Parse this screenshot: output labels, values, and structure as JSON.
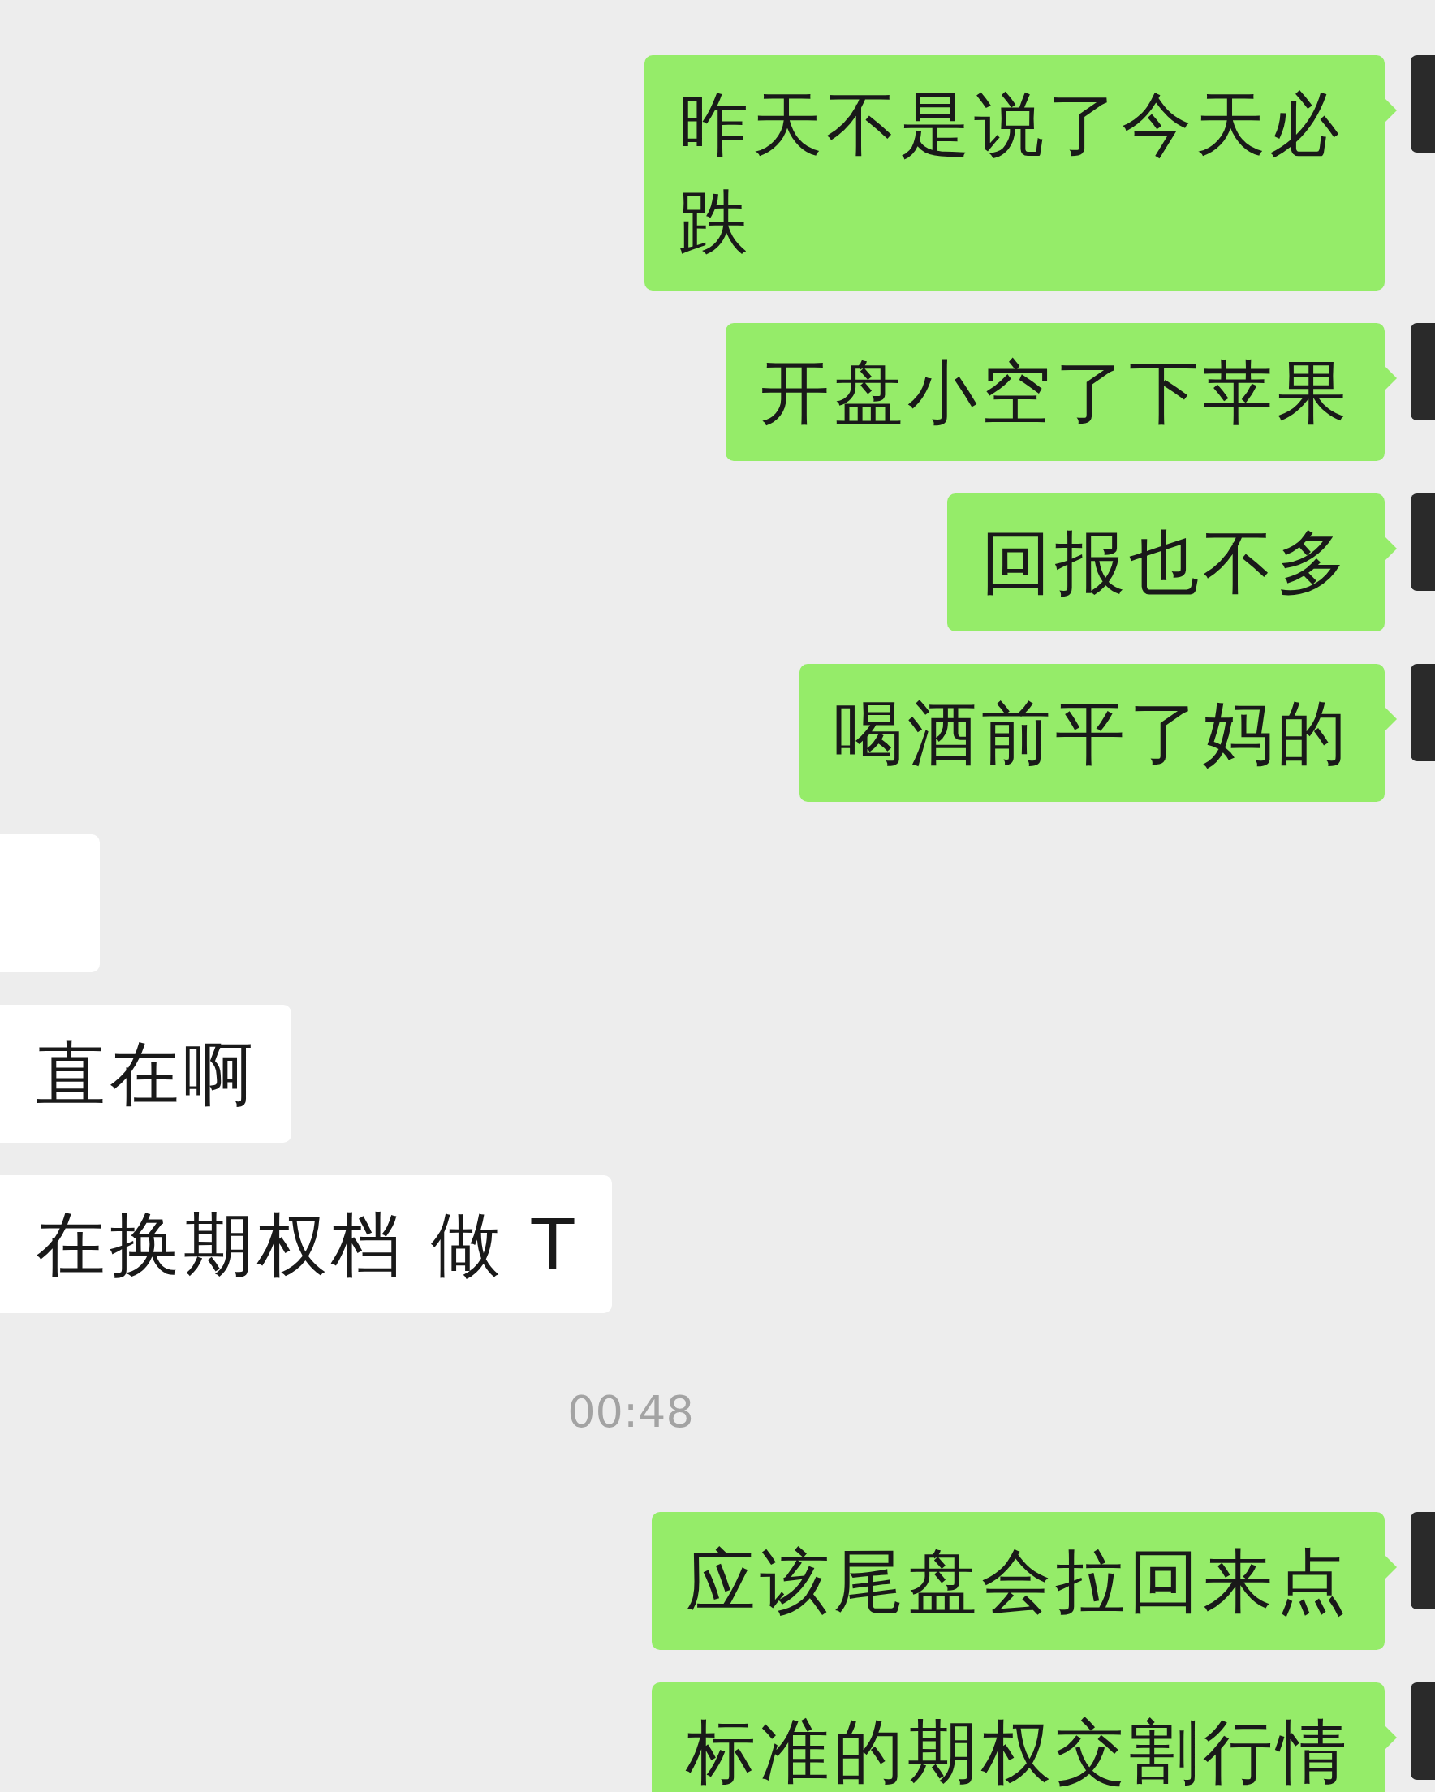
{
  "messages": [
    {
      "kind": "outgoing",
      "text": "昨天不是说了今天必跌"
    },
    {
      "kind": "outgoing",
      "text": "开盘小空了下苹果"
    },
    {
      "kind": "outgoing",
      "text": "回报也不多"
    },
    {
      "kind": "outgoing",
      "text": "喝酒前平了妈的"
    },
    {
      "kind": "incoming"
    },
    {
      "kind": "incoming",
      "text": "直在啊"
    },
    {
      "kind": "incoming",
      "text": "在换期权档 做 T"
    },
    {
      "kind": "time",
      "text": "00:48"
    },
    {
      "kind": "outgoing",
      "text": "应该尾盘会拉回来点"
    },
    {
      "kind": "outgoing",
      "text": "标准的期权交割行情"
    }
  ]
}
